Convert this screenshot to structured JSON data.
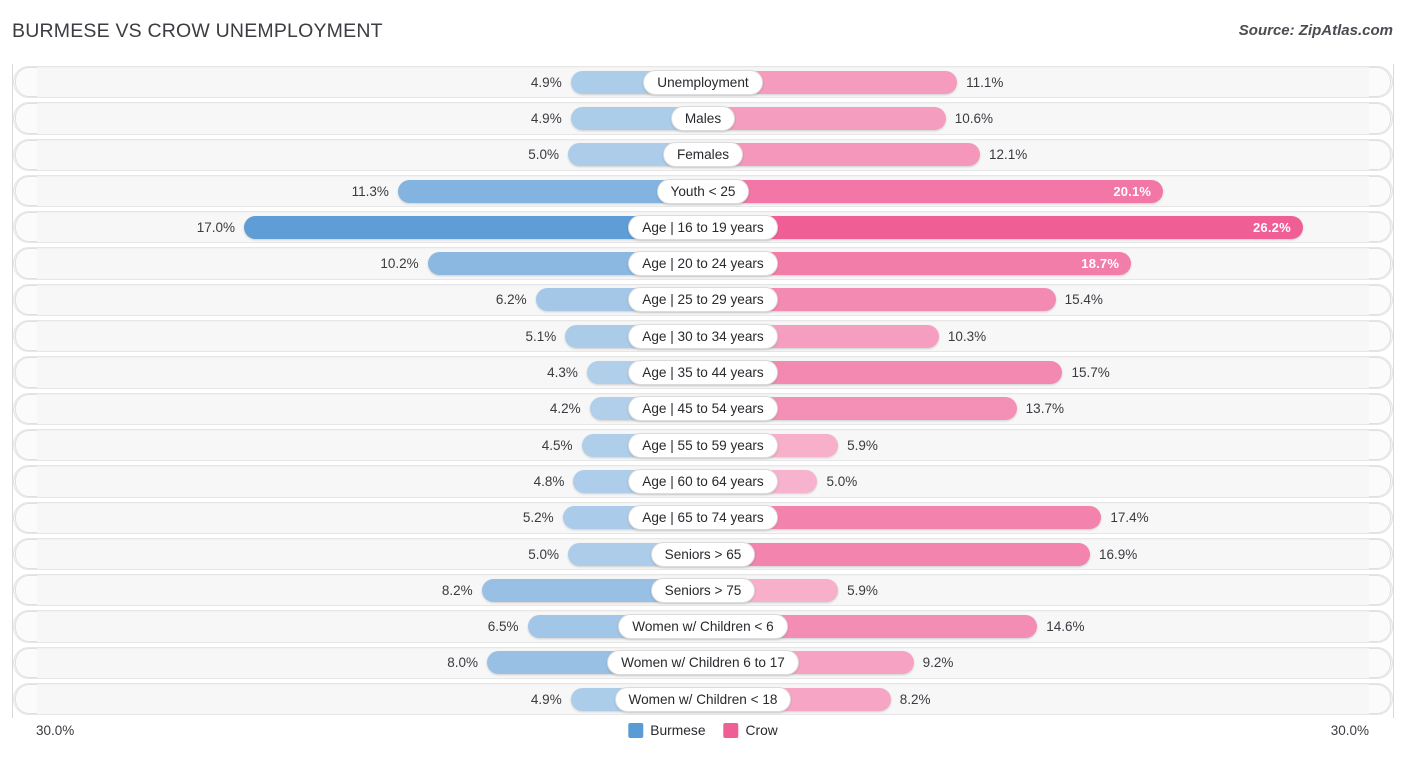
{
  "header": {
    "title": "BURMESE VS CROW UNEMPLOYMENT",
    "source": "Source: ZipAtlas.com"
  },
  "axis": {
    "left_label": "30.0%",
    "right_label": "30.0%",
    "max": 30.0
  },
  "legend": {
    "items": [
      {
        "label": "Burmese",
        "color": "#5b9bd5"
      },
      {
        "label": "Crow",
        "color": "#ef5e95"
      }
    ]
  },
  "chart_data": {
    "type": "bar",
    "orientation": "horizontal-diverging",
    "title": "BURMESE VS CROW UNEMPLOYMENT",
    "xlabel": "",
    "ylabel": "",
    "xlim": [
      0,
      30
    ],
    "grid": false,
    "legend_position": "bottom-center",
    "categories": [
      "Unemployment",
      "Males",
      "Females",
      "Youth < 25",
      "Age | 16 to 19 years",
      "Age | 20 to 24 years",
      "Age | 25 to 29 years",
      "Age | 30 to 34 years",
      "Age | 35 to 44 years",
      "Age | 45 to 54 years",
      "Age | 55 to 59 years",
      "Age | 60 to 64 years",
      "Age | 65 to 74 years",
      "Seniors > 65",
      "Seniors > 75",
      "Women w/ Children < 6",
      "Women w/ Children 6 to 17",
      "Women w/ Children < 18"
    ],
    "series": [
      {
        "name": "Burmese",
        "color": "#5b9bd5",
        "values": [
          4.9,
          4.9,
          5.0,
          11.3,
          17.0,
          10.2,
          6.2,
          5.1,
          4.3,
          4.2,
          4.5,
          4.8,
          5.2,
          5.0,
          8.2,
          6.5,
          8.0,
          4.9
        ],
        "labels": [
          "4.9%",
          "4.9%",
          "5.0%",
          "11.3%",
          "17.0%",
          "10.2%",
          "6.2%",
          "5.1%",
          "4.3%",
          "4.2%",
          "4.5%",
          "4.8%",
          "5.2%",
          "5.0%",
          "8.2%",
          "6.5%",
          "8.0%",
          "4.9%"
        ]
      },
      {
        "name": "Crow",
        "color": "#ef5e95",
        "values": [
          11.1,
          10.6,
          12.1,
          20.1,
          26.2,
          18.7,
          15.4,
          10.3,
          15.7,
          13.7,
          5.9,
          5.0,
          17.4,
          16.9,
          5.9,
          14.6,
          9.2,
          8.2
        ],
        "labels": [
          "11.1%",
          "10.6%",
          "12.1%",
          "20.1%",
          "26.2%",
          "18.7%",
          "15.4%",
          "10.3%",
          "15.7%",
          "13.7%",
          "5.9%",
          "5.0%",
          "17.4%",
          "16.9%",
          "5.9%",
          "14.6%",
          "9.2%",
          "8.2%"
        ]
      }
    ]
  }
}
